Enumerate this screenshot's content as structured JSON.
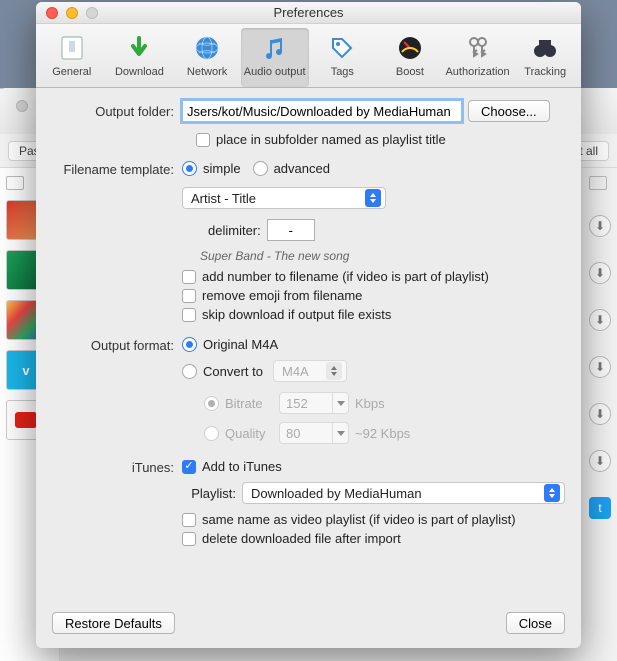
{
  "bg": {
    "past_label": "Past",
    "rt_all_label": "rt all"
  },
  "window": {
    "title": "Preferences"
  },
  "toolbar": {
    "items": [
      {
        "label": "General"
      },
      {
        "label": "Download"
      },
      {
        "label": "Network"
      },
      {
        "label": "Audio output"
      },
      {
        "label": "Tags"
      },
      {
        "label": "Boost"
      },
      {
        "label": "Authorization"
      },
      {
        "label": "Tracking"
      }
    ]
  },
  "output_folder": {
    "label": "Output folder:",
    "value": "Jsers/kot/Music/Downloaded by MediaHuman",
    "choose_btn": "Choose...",
    "subfolder_checkbox": "place in subfolder named as playlist title"
  },
  "filename": {
    "label": "Filename template:",
    "simple": "simple",
    "advanced": "advanced",
    "template_popup": "Artist - Title",
    "delimiter_label": "delimiter:",
    "delimiter_value": "-",
    "example": "Super Band - The new song",
    "opt_number": "add number to filename (if video is part of playlist)",
    "opt_emoji": "remove emoji from filename",
    "opt_skip": "skip download if output file exists"
  },
  "format": {
    "label": "Output format:",
    "original": "Original M4A",
    "convert_to": "Convert to",
    "convert_fmt": "M4A",
    "bitrate_label": "Bitrate",
    "bitrate_value": "152",
    "bitrate_unit": "Kbps",
    "quality_label": "Quality",
    "quality_value": "80",
    "quality_est": "~92 Kbps"
  },
  "itunes": {
    "label": "iTunes:",
    "add": "Add to iTunes",
    "playlist_label": "Playlist:",
    "playlist_value": "Downloaded by MediaHuman",
    "same_name": "same name as video playlist (if video is part of playlist)",
    "delete_after": "delete downloaded file after import"
  },
  "footer": {
    "restore": "Restore Defaults",
    "close": "Close"
  }
}
